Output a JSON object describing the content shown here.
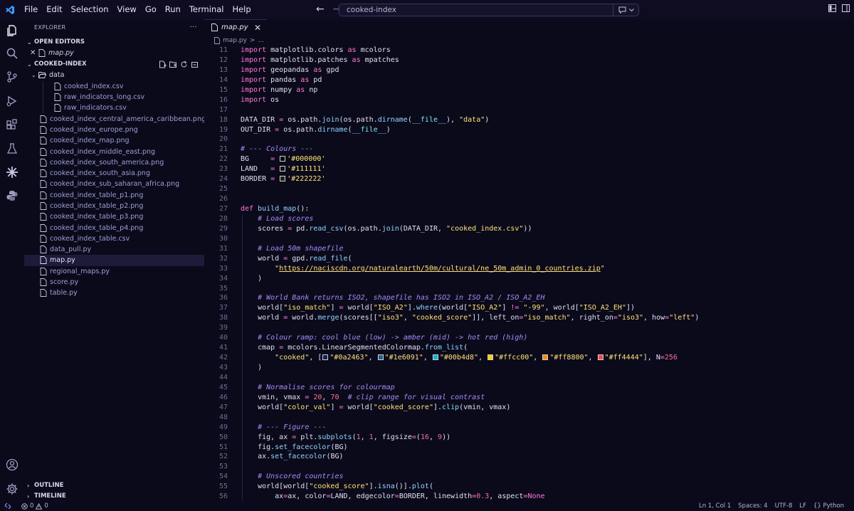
{
  "menu": [
    "File",
    "Edit",
    "Selection",
    "View",
    "Go",
    "Run",
    "Terminal",
    "Help"
  ],
  "search": {
    "text": "cooked-index"
  },
  "sidebar": {
    "title": "EXPLORER",
    "more": "···",
    "open_editors": {
      "label": "OPEN EDITORS",
      "items": [
        {
          "name": "map.py"
        }
      ]
    },
    "folder": {
      "label": "COOKED-INDEX",
      "data_folder": "data",
      "data_files": [
        "cooked_index.csv",
        "raw_indicators_long.csv",
        "raw_indicators.csv"
      ],
      "files": [
        "cooked_index_central_america_caribbean.png",
        "cooked_index_europe.png",
        "cooked_index_map.png",
        "cooked_index_middle_east.png",
        "cooked_index_south_america.png",
        "cooked_index_south_asia.png",
        "cooked_index_sub_saharan_africa.png",
        "cooked_index_table_p1.png",
        "cooked_index_table_p2.png",
        "cooked_index_table_p3.png",
        "cooked_index_table_p4.png",
        "cooked_index_table.csv",
        "data_pull.py",
        "map.py",
        "regional_maps.py",
        "score.py",
        "table.py"
      ],
      "active_file": "map.py"
    },
    "outline": "OUTLINE",
    "timeline": "TIMELINE"
  },
  "editor": {
    "tab": {
      "label": "map.py",
      "close": "✕"
    },
    "breadcrumb": [
      "map.py",
      ">",
      "..."
    ],
    "lines": [
      {
        "n": "11",
        "i": 0,
        "html": "<span class=\"kw\">import</span> matplotlib.colors <span class=\"kw\">as</span> mcolors"
      },
      {
        "n": "12",
        "i": 0,
        "html": "<span class=\"kw\">import</span> matplotlib.patches <span class=\"kw\">as</span> mpatches"
      },
      {
        "n": "13",
        "i": 0,
        "html": "<span class=\"kw\">import</span> geopandas <span class=\"kw\">as</span> gpd"
      },
      {
        "n": "14",
        "i": 0,
        "html": "<span class=\"kw\">import</span> pandas <span class=\"kw\">as</span> pd"
      },
      {
        "n": "15",
        "i": 0,
        "html": "<span class=\"kw\">import</span> numpy <span class=\"kw\">as</span> np"
      },
      {
        "n": "16",
        "i": 0,
        "html": "<span class=\"kw\">import</span> os"
      },
      {
        "n": "17",
        "i": 0,
        "html": ""
      },
      {
        "n": "18",
        "i": 0,
        "html": "DATA_DIR <span class=\"op\">=</span> os.path.<span class=\"fn\">join</span>(os.path.<span class=\"fn\">dirname</span>(<span class=\"bi\">__file__</span>), <span class=\"st\">\"data\"</span>)"
      },
      {
        "n": "19",
        "i": 0,
        "html": "OUT_DIR <span class=\"op\">=</span> os.path.<span class=\"fn\">dirname</span>(<span class=\"bi\">__file__</span>)"
      },
      {
        "n": "20",
        "i": 0,
        "html": ""
      },
      {
        "n": "21",
        "i": 0,
        "html": "<span class=\"cm\"># --- Colours ---</span>"
      },
      {
        "n": "22",
        "i": 0,
        "html": "BG     <span class=\"op\">=</span> <span class=\"sw\" style=\"background:#000000\"></span><span class=\"st\">'#000000'</span>"
      },
      {
        "n": "23",
        "i": 0,
        "html": "LAND   <span class=\"op\">=</span> <span class=\"sw\" style=\"background:#111111\"></span><span class=\"st\">'#111111'</span>"
      },
      {
        "n": "24",
        "i": 0,
        "html": "BORDER <span class=\"op\">=</span> <span class=\"sw\" style=\"background:#222222\"></span><span class=\"st\">'#222222'</span>"
      },
      {
        "n": "25",
        "i": 0,
        "html": ""
      },
      {
        "n": "26",
        "i": 0,
        "html": ""
      },
      {
        "n": "27",
        "i": 0,
        "html": "<span class=\"kw\">def</span> <span class=\"fn\">build_map</span>():"
      },
      {
        "n": "28",
        "i": 1,
        "html": "    <span class=\"cm\"># Load scores</span>"
      },
      {
        "n": "29",
        "i": 1,
        "html": "    scores <span class=\"op\">=</span> pd.<span class=\"fn\">read_csv</span>(os.path.<span class=\"fn\">join</span>(DATA_DIR, <span class=\"st\">\"cooked_index.csv\"</span>))"
      },
      {
        "n": "30",
        "i": 1,
        "html": ""
      },
      {
        "n": "31",
        "i": 1,
        "html": "    <span class=\"cm\"># Load 50m shapefile</span>"
      },
      {
        "n": "32",
        "i": 1,
        "html": "    world <span class=\"op\">=</span> gpd.<span class=\"fn\">read_file</span>("
      },
      {
        "n": "33",
        "i": 1,
        "html": "        <span class=\"st\">\"</span><span class=\"url\">https://naciscdn.org/naturalearth/50m/cultural/ne_50m_admin_0_countries.zip</span><span class=\"st\">\"</span>"
      },
      {
        "n": "34",
        "i": 1,
        "html": "    )"
      },
      {
        "n": "35",
        "i": 1,
        "html": ""
      },
      {
        "n": "36",
        "i": 1,
        "html": "    <span class=\"cm\"># World Bank returns ISO2, shapefile has ISO2 in ISO_A2 / ISO_A2_EH</span>"
      },
      {
        "n": "37",
        "i": 1,
        "html": "    world[<span class=\"st\">\"iso_match\"</span>] <span class=\"op\">=</span> world[<span class=\"st\">\"ISO_A2\"</span>].<span class=\"fn\">where</span>(world[<span class=\"st\">\"ISO_A2\"</span>] <span class=\"op\">!=</span> <span class=\"st\">\"-99\"</span>, world[<span class=\"st\">\"ISO_A2_EH\"</span>])"
      },
      {
        "n": "38",
        "i": 1,
        "html": "    world <span class=\"op\">=</span> world.<span class=\"fn\">merge</span>(scores[[<span class=\"st\">\"iso3\"</span>, <span class=\"st\">\"cooked_score\"</span>]], left_on<span class=\"op\">=</span><span class=\"st\">\"iso_match\"</span>, right_on<span class=\"op\">=</span><span class=\"st\">\"iso3\"</span>, how<span class=\"op\">=</span><span class=\"st\">\"left\"</span>)"
      },
      {
        "n": "39",
        "i": 1,
        "html": ""
      },
      {
        "n": "40",
        "i": 1,
        "html": "    <span class=\"cm\"># Colour ramp: cool blue (low) -&gt; amber (mid) -&gt; hot red (high)</span>"
      },
      {
        "n": "41",
        "i": 1,
        "html": "    cmap <span class=\"op\">=</span> mcolors.LinearSegmentedColormap.<span class=\"fn\">from_list</span>("
      },
      {
        "n": "42",
        "i": 1,
        "html": "        <span class=\"st\">\"cooked\"</span>, [<span class=\"sw\" style=\"background:#0a2463\"></span><span class=\"st\">\"#0a2463\"</span>, <span class=\"sw\" style=\"background:#1e6091\"></span><span class=\"st\">\"#1e6091\"</span>, <span class=\"sw\" style=\"background:#00b4d8\"></span><span class=\"st\">\"#00b4d8\"</span>, <span class=\"sw\" style=\"background:#ffcc00\"></span><span class=\"st\">\"#ffcc00\"</span>, <span class=\"sw\" style=\"background:#ff8800\"></span><span class=\"st\">\"#ff8800\"</span>, <span class=\"sw\" style=\"background:#ff4444\"></span><span class=\"st\">\"#ff4444\"</span>], N<span class=\"op\">=</span><span class=\"num\">256</span>"
      },
      {
        "n": "43",
        "i": 1,
        "html": "    )"
      },
      {
        "n": "44",
        "i": 1,
        "html": ""
      },
      {
        "n": "45",
        "i": 1,
        "html": "    <span class=\"cm\"># Normalise scores for colourmap</span>"
      },
      {
        "n": "46",
        "i": 1,
        "html": "    vmin, vmax <span class=\"op\">=</span> <span class=\"num\">20</span>, <span class=\"num\">70</span>  <span class=\"cm\"># clip range for visual contrast</span>"
      },
      {
        "n": "47",
        "i": 1,
        "html": "    world[<span class=\"st\">\"color_val\"</span>] <span class=\"op\">=</span> world[<span class=\"st\">\"cooked_score\"</span>].<span class=\"fn\">clip</span>(vmin, vmax)"
      },
      {
        "n": "48",
        "i": 1,
        "html": ""
      },
      {
        "n": "49",
        "i": 1,
        "html": "    <span class=\"cm\"># --- Figure ---</span>"
      },
      {
        "n": "50",
        "i": 1,
        "html": "    fig, ax <span class=\"op\">=</span> plt.<span class=\"fn\">subplots</span>(<span class=\"num\">1</span>, <span class=\"num\">1</span>, figsize<span class=\"op\">=</span>(<span class=\"num\">16</span>, <span class=\"num\">9</span>))"
      },
      {
        "n": "51",
        "i": 1,
        "html": "    fig.<span class=\"fn\">set_facecolor</span>(BG)"
      },
      {
        "n": "52",
        "i": 1,
        "html": "    ax.<span class=\"fn\">set_facecolor</span>(BG)"
      },
      {
        "n": "53",
        "i": 1,
        "html": ""
      },
      {
        "n": "54",
        "i": 1,
        "html": "    <span class=\"cm\"># Unscored countries</span>"
      },
      {
        "n": "55",
        "i": 1,
        "html": "    world[world[<span class=\"st\">\"cooked_score\"</span>].<span class=\"fn\">isna</span>()].<span class=\"fn\">plot</span>("
      },
      {
        "n": "56",
        "i": 1,
        "html": "        ax<span class=\"op\">=</span>ax, color<span class=\"op\">=</span>LAND, edgecolor<span class=\"op\">=</span>BORDER, linewidth<span class=\"op\">=</span><span class=\"num\">0.3</span>, aspect<span class=\"op\">=</span><span class=\"kw\">None</span>"
      }
    ]
  },
  "status": {
    "errors": "0",
    "warnings": "0",
    "position": "Ln 1, Col 1",
    "spaces": "Spaces: 4",
    "encoding": "UTF-8",
    "eol": "LF",
    "language_braces": "{}",
    "language": "Python"
  },
  "colors": {
    "accent": "#9d8cff",
    "file_link": "#9d9fd9",
    "background": "#0b0a1a"
  }
}
